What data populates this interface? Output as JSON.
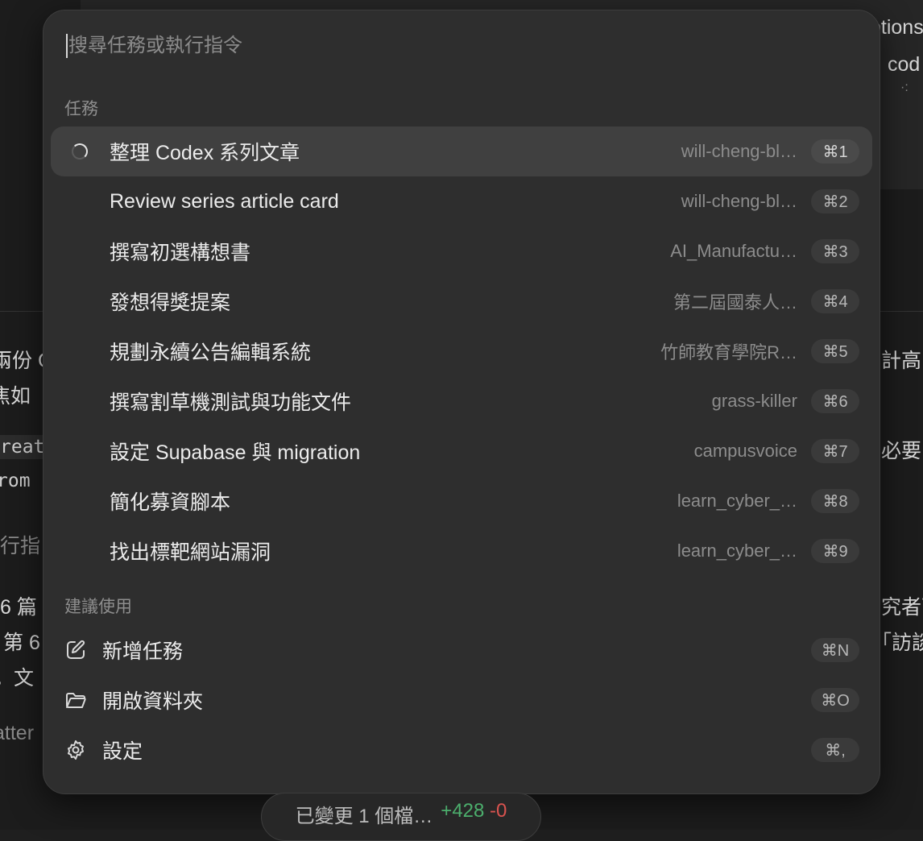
{
  "background": {
    "top_right": [
      "otions",
      "cod",
      "·:"
    ],
    "left_fragments": [
      "兩份 G",
      "焦如",
      "reat",
      "rom",
      "行指",
      "6 篇",
      "第 6",
      "。文",
      "atter"
    ],
    "right_fragments": [
      "計高",
      "必要的",
      "究者可",
      "「訪談"
    ]
  },
  "search": {
    "placeholder": "搜尋任務或執行指令",
    "value": ""
  },
  "tasks": {
    "section_label": "任務",
    "items": [
      {
        "title": "整理 Codex 系列文章",
        "project": "will-cheng-bl…",
        "shortcut": "⌘1",
        "active": true,
        "running": true
      },
      {
        "title": "Review series article card",
        "project": "will-cheng-bl…",
        "shortcut": "⌘2"
      },
      {
        "title": "撰寫初選構想書",
        "project": "AI_Manufactu…",
        "shortcut": "⌘3"
      },
      {
        "title": "發想得獎提案",
        "project": "第二屆國泰人…",
        "shortcut": "⌘4"
      },
      {
        "title": "規劃永續公告編輯系統",
        "project": "竹師教育學院R…",
        "shortcut": "⌘5"
      },
      {
        "title": "撰寫割草機測試與功能文件",
        "project": "grass-killer",
        "shortcut": "⌘6"
      },
      {
        "title": "設定 Supabase 與 migration",
        "project": "campusvoice",
        "shortcut": "⌘7"
      },
      {
        "title": "簡化募資腳本",
        "project": "learn_cyber_…",
        "shortcut": "⌘8"
      },
      {
        "title": "找出標靶網站漏洞",
        "project": "learn_cyber_…",
        "shortcut": "⌘9"
      }
    ]
  },
  "suggestions": {
    "section_label": "建議使用",
    "items": [
      {
        "icon": "edit-icon",
        "title": "新增任務",
        "shortcut": "⌘N"
      },
      {
        "icon": "folder-icon",
        "title": "開啟資料夾",
        "shortcut": "⌘O"
      },
      {
        "icon": "gear-icon",
        "title": "設定",
        "shortcut": "⌘,"
      }
    ]
  },
  "status": {
    "label": "已變更 1 個檔…",
    "additions": "+428",
    "deletions": "-0"
  },
  "colors": {
    "palette_bg": "#2e2e2e",
    "active_row_bg": "#404040",
    "additions": "#4caf6d",
    "deletions": "#d9534f"
  }
}
